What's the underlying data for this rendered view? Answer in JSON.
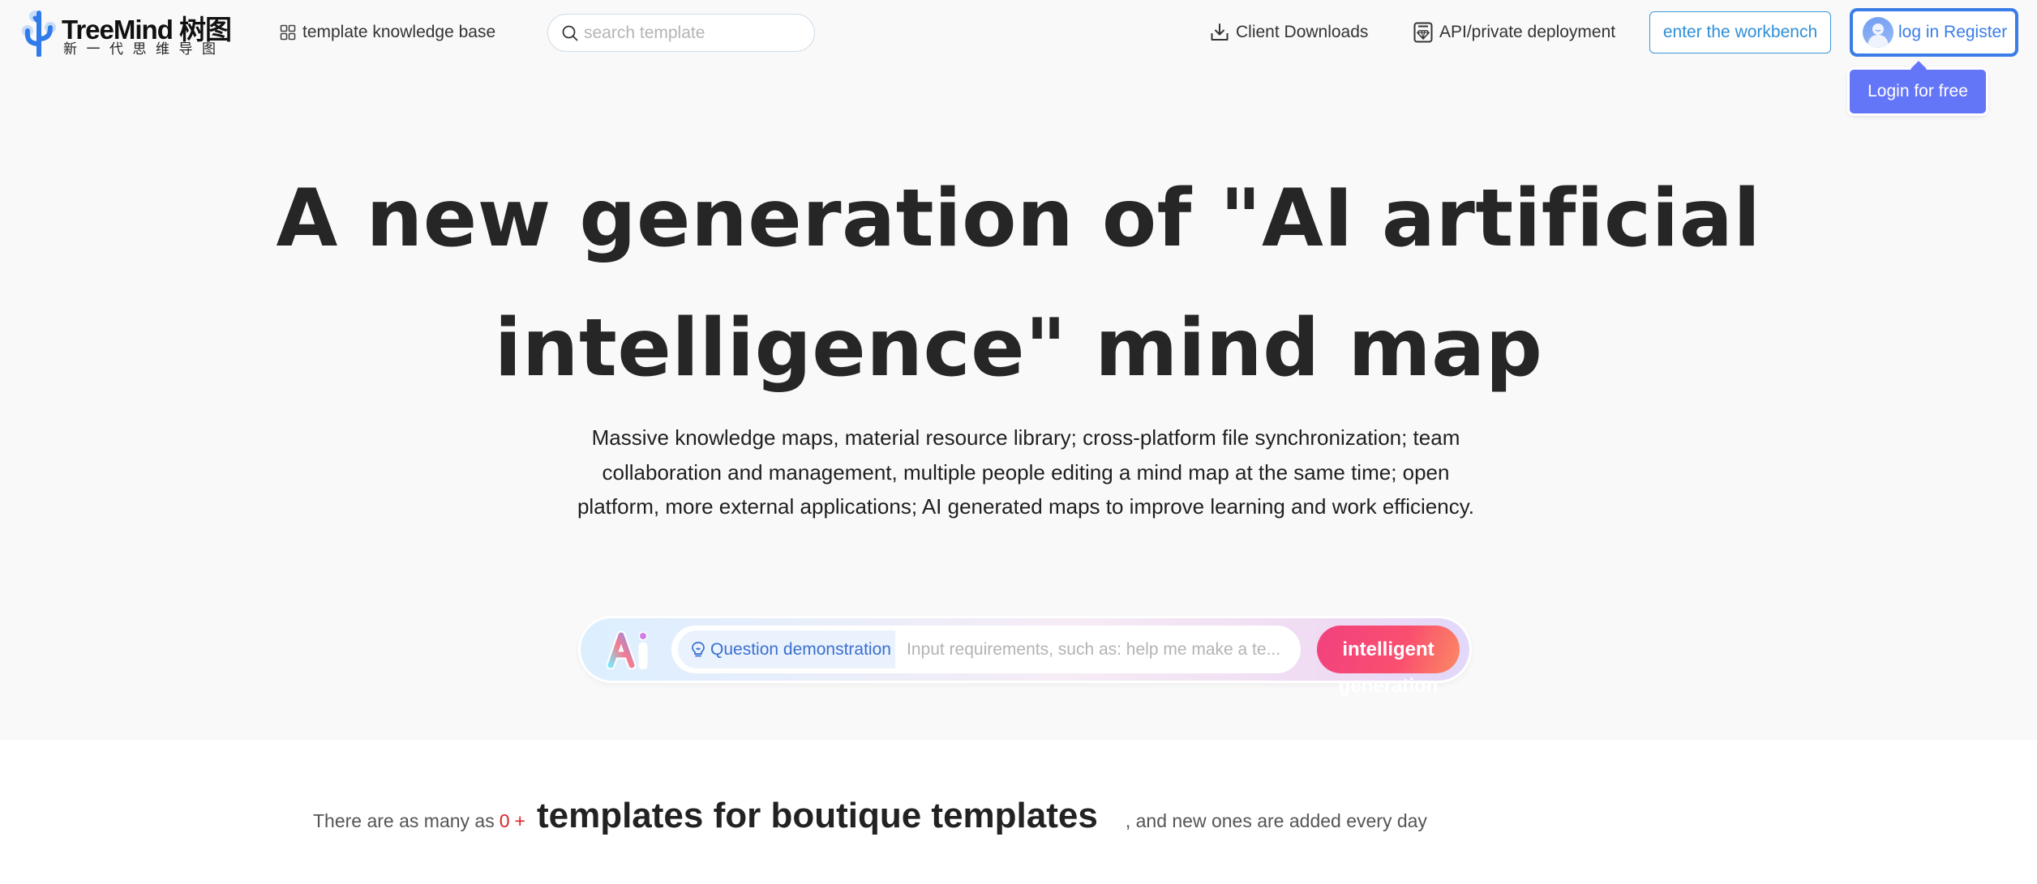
{
  "header": {
    "logo": {
      "name": "TreeMind 树图",
      "tagline": "新一代思维导图"
    },
    "nav": {
      "templates": {
        "label": "template knowledge base",
        "icon": "grid-icon"
      },
      "downloads": {
        "label": "Client Downloads",
        "icon": "download-icon"
      },
      "api": {
        "label": "API/private deployment",
        "icon": "diamond-icon"
      }
    },
    "search": {
      "placeholder": "search template",
      "value": "",
      "icon": "search-icon"
    },
    "workbench_label": "enter the workbench",
    "login_label": "log in Register",
    "login_tooltip": "Login for free"
  },
  "hero": {
    "headline": "A new generation of \"AI artificial intelligence\" mind map",
    "description": "Massive knowledge maps, material resource library; cross-platform file synchronization; team collaboration and management, multiple people editing a mind map at the same time; open platform, more external applications; AI generated maps to improve learning and work efficiency."
  },
  "ai_bar": {
    "logo_text": "Ai",
    "demo_label": "Question demonstration",
    "input_placeholder": "Input requirements, such as: help me make a te...",
    "input_value": "",
    "button_line1": "intelligent",
    "button_line2": "generation"
  },
  "stats": {
    "prefix": "There are as many as",
    "count": "0",
    "plus": "+",
    "headline": "templates for boutique templates",
    "suffix": ", and new ones are added every day"
  },
  "colors": {
    "accent_blue": "#3b7de8",
    "workbench_blue": "#2f8fd6",
    "tooltip_purple": "#6476f8",
    "generate_pink": "#fa4f6f",
    "count_red": "#d8232a"
  }
}
